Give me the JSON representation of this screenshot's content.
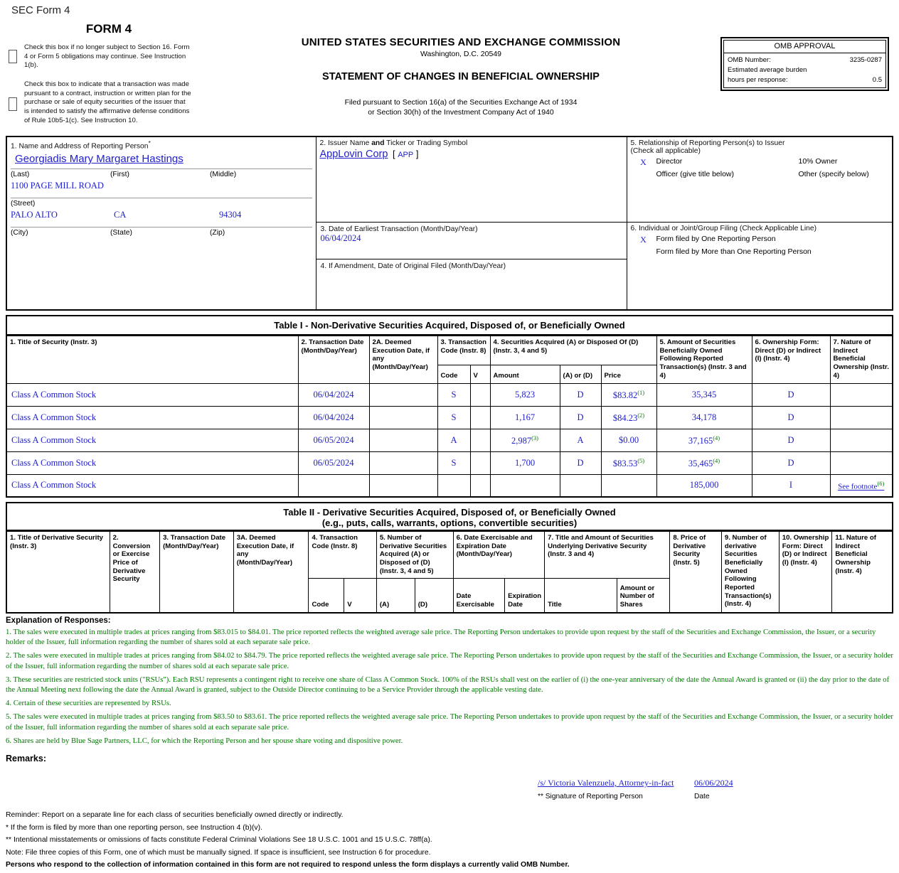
{
  "header": {
    "sec_form_label": "SEC Form 4",
    "form_title": "FORM 4",
    "agency": "UNITED STATES SECURITIES AND EXCHANGE COMMISSION",
    "city": "Washington, D.C. 20549",
    "statement_title": "STATEMENT OF CHANGES IN BENEFICIAL OWNERSHIP",
    "filed_line1": "Filed pursuant to Section 16(a) of the Securities Exchange Act of 1934",
    "filed_line2": "or Section 30(h) of the Investment Company Act of 1940"
  },
  "omb": {
    "title": "OMB APPROVAL",
    "number_label": "OMB Number:",
    "number_value": "3235-0287",
    "burden_label_line1": "Estimated average burden",
    "burden_label_line2": "hours per response:",
    "burden_value": "0.5"
  },
  "checkboxes": [
    {
      "name": "no-longer-subject-section16",
      "text": "Check this box if no longer subject to Section 16. Form 4 or Form 5 obligations may continue. See Instruction 1(b).",
      "checked": false
    },
    {
      "name": "rule-10b5-1c-plan",
      "text": "Check this box to indicate that a transaction was made pursuant to a contract, instruction or written plan for the purchase or sale of equity securities of the issuer that is intended to satisfy the affirmative defense conditions of Rule 10b5-1(c). See Instruction 10.",
      "checked": false
    }
  ],
  "box1": {
    "label": "1. Name and Address of Reporting Person",
    "person_name": "Georgiadis Mary Margaret Hastings",
    "sub_last": "(Last)",
    "sub_first": "(First)",
    "sub_middle": "(Middle)",
    "street": "1100 PAGE MILL ROAD",
    "sub_street": "(Street)",
    "city": "PALO ALTO",
    "state": "CA",
    "zip": "94304",
    "sub_city": "(City)",
    "sub_state": "(State)",
    "sub_zip": "(Zip)"
  },
  "box2": {
    "label_a": "2. Issuer Name ",
    "label_b": "and",
    "label_c": " Ticker or Trading Symbol",
    "issuer": "AppLovin Corp",
    "bracket_open": "[",
    "ticker": "APP",
    "bracket_close": "]"
  },
  "box3": {
    "label": "3. Date of Earliest Transaction (Month/Day/Year)",
    "value": "06/04/2024"
  },
  "box4": {
    "label": "4. If Amendment, Date of Original Filed (Month/Day/Year)",
    "value": ""
  },
  "box5": {
    "label_line1": "5. Relationship of Reporting Person(s) to Issuer",
    "label_line2": "(Check all applicable)",
    "rows": [
      {
        "mark": "X",
        "left": "Director",
        "right": "10% Owner"
      },
      {
        "mark": "",
        "left": "Officer (give title below)",
        "right": "Other (specify below)"
      }
    ]
  },
  "box6": {
    "label": "6. Individual or Joint/Group Filing (Check Applicable Line)",
    "rows": [
      {
        "mark": "X",
        "text": "Form filed by One Reporting Person"
      },
      {
        "mark": "",
        "text": "Form filed by More than One Reporting Person"
      }
    ]
  },
  "table1": {
    "title": "Table I - Non-Derivative Securities Acquired, Disposed of, or Beneficially Owned",
    "headers": {
      "h1": "1. Title of Security (Instr. 3)",
      "h2": "2. Transaction Date (Month/Day/Year)",
      "h2a": "2A. Deemed Execution Date, if any (Month/Day/Year)",
      "h3": "3. Transaction Code (Instr. 8)",
      "h4": "4. Securities Acquired (A) or Disposed Of (D) (Instr. 3, 4 and 5)",
      "h5": "5. Amount of Securities Beneficially Owned Following Reported Transaction(s) (Instr. 3 and 4)",
      "h6": "6. Ownership Form: Direct (D) or Indirect (I) (Instr. 4)",
      "h7": "7. Nature of Indirect Beneficial Ownership (Instr. 4)",
      "sub_code": "Code",
      "sub_v": "V",
      "sub_amount": "Amount",
      "sub_ad": "(A) or (D)",
      "sub_price": "Price"
    },
    "rows": [
      {
        "title": "Class A Common Stock",
        "date": "06/04/2024",
        "deemed": "",
        "code": "S",
        "v": "",
        "amount": "5,823",
        "amount_fn": "",
        "ad": "D",
        "price": "$83.82",
        "price_fn": "(1)",
        "owned": "35,345",
        "owned_fn": "",
        "form": "D",
        "nature": "",
        "nature_fn": ""
      },
      {
        "title": "Class A Common Stock",
        "date": "06/04/2024",
        "deemed": "",
        "code": "S",
        "v": "",
        "amount": "1,167",
        "amount_fn": "",
        "ad": "D",
        "price": "$84.23",
        "price_fn": "(2)",
        "owned": "34,178",
        "owned_fn": "",
        "form": "D",
        "nature": "",
        "nature_fn": ""
      },
      {
        "title": "Class A Common Stock",
        "date": "06/05/2024",
        "deemed": "",
        "code": "A",
        "v": "",
        "amount": "2,987",
        "amount_fn": "(3)",
        "ad": "A",
        "price": "$0.00",
        "price_fn": "",
        "owned": "37,165",
        "owned_fn": "(4)",
        "form": "D",
        "nature": "",
        "nature_fn": ""
      },
      {
        "title": "Class A Common Stock",
        "date": "06/05/2024",
        "deemed": "",
        "code": "S",
        "v": "",
        "amount": "1,700",
        "amount_fn": "",
        "ad": "D",
        "price": "$83.53",
        "price_fn": "(5)",
        "owned": "35,465",
        "owned_fn": "(4)",
        "form": "D",
        "nature": "",
        "nature_fn": ""
      },
      {
        "title": "Class A Common Stock",
        "date": "",
        "deemed": "",
        "code": "",
        "v": "",
        "amount": "",
        "amount_fn": "",
        "ad": "",
        "price": "",
        "price_fn": "",
        "owned": "185,000",
        "owned_fn": "",
        "form": "I",
        "nature": "See footnote",
        "nature_fn": "(6)"
      }
    ]
  },
  "table2": {
    "title_line1": "Table II - Derivative Securities Acquired, Disposed of, or Beneficially Owned",
    "title_line2": "(e.g., puts, calls, warrants, options, convertible securities)",
    "headers": {
      "h1": "1. Title of Derivative Security (Instr. 3)",
      "h2": "2. Conversion or Exercise Price of Derivative Security",
      "h3": "3. Transaction Date (Month/Day/Year)",
      "h3a": "3A. Deemed Execution Date, if any (Month/Day/Year)",
      "h4": "4. Transaction Code (Instr. 8)",
      "h5": "5. Number of Derivative Securities Acquired (A) or Disposed of (D) (Instr. 3, 4 and 5)",
      "h6": "6. Date Exercisable and Expiration Date (Month/Day/Year)",
      "h7": "7. Title and Amount of Securities Underlying Derivative Security (Instr. 3 and 4)",
      "h8": "8. Price of Derivative Security (Instr. 5)",
      "h9": "9. Number of derivative Securities Beneficially Owned Following Reported Transaction(s) (Instr. 4)",
      "h10": "10. Ownership Form: Direct (D) or Indirect (I) (Instr. 4)",
      "h11": "11. Nature of Indirect Beneficial Ownership (Instr. 4)",
      "sub_code": "Code",
      "sub_v": "V",
      "sub_a": "(A)",
      "sub_d": "(D)",
      "sub_date_exercisable": "Date Exercisable",
      "sub_expiration_date": "Expiration Date",
      "sub_title": "Title",
      "sub_amount_shares": "Amount or Number of Shares"
    },
    "rows": []
  },
  "explanation": {
    "title": "Explanation of Responses:",
    "notes": [
      "1. The sales were executed in multiple trades at prices ranging from $83.015 to $84.01. The price reported reflects the weighted average sale price. The Reporting Person undertakes to provide upon request by the staff of the Securities and Exchange Commission, the Issuer, or a security holder of the Issuer, full information regarding the number of shares sold at each separate sale price.",
      "2. The sales were executed in multiple trades at prices ranging from $84.02 to $84.79. The price reported reflects the weighted average sale price. The Reporting Person undertakes to provide upon request by the staff of the Securities and Exchange Commission, the Issuer, or a security holder of the Issuer, full information regarding the number of shares sold at each separate sale price.",
      "3. These securities are restricted stock units (\"RSUs\"). Each RSU represents a contingent right to receive one share of Class A Common Stock. 100% of the RSUs shall vest on the earlier of (i) the one-year anniversary of the date the Annual Award is granted or (ii) the day prior to the date of the Annual Meeting next following the date the Annual Award is granted, subject to the Outside Director continuing to be a Service Provider through the applicable vesting date.",
      "4. Certain of these securities are represented by RSUs.",
      "5. The sales were executed in multiple trades at prices ranging from $83.50 to $83.61. The price reported reflects the weighted average sale price. The Reporting Person undertakes to provide upon request by the staff of the Securities and Exchange Commission, the Issuer, or a security holder of the Issuer, full information regarding the number of shares sold at each separate sale price.",
      "6. Shares are held by Blue Sage Partners, LLC, for which the Reporting Person and her spouse share voting and dispositive power."
    ]
  },
  "remarks": {
    "label": "Remarks:",
    "value": ""
  },
  "signature": {
    "name": "/s/ Victoria Valenzuela, Attorney-in-fact",
    "date": "06/06/2024",
    "caption": "** Signature of Reporting Person",
    "date_caption": "Date"
  },
  "footer": {
    "lines": [
      "Reminder: Report on a separate line for each class of securities beneficially owned directly or indirectly.",
      "* If the form is filed by more than one reporting person, see Instruction 4 (b)(v).",
      "** Intentional misstatements or omissions of facts constitute Federal Criminal Violations See 18 U.S.C. 1001 and 15 U.S.C. 78ff(a).",
      "Note: File three copies of this Form, one of which must be manually signed. If space is insufficient, see Instruction 6 for procedure."
    ],
    "bold_line": "Persons who respond to the collection of information contained in this form are not required to respond unless the form displays a currently valid OMB Number."
  }
}
